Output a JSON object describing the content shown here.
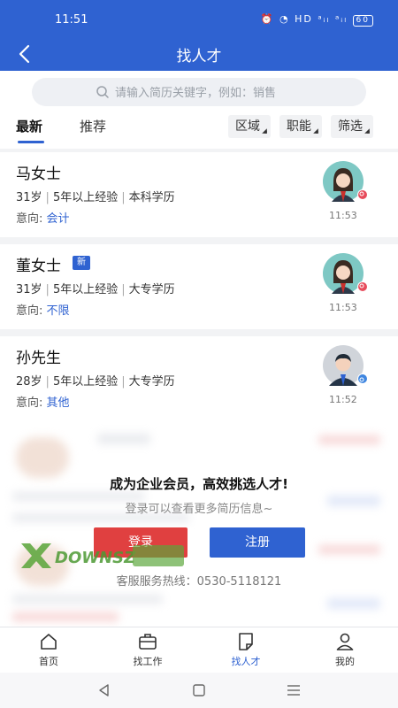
{
  "status_bar": {
    "time": "11:51",
    "battery": "60",
    "signal": "HD ᵃᵢₗ ᵃᵢₗ"
  },
  "nav": {
    "title": "找人才",
    "back_icon": "back-arrow-icon"
  },
  "search": {
    "placeholder": "请输入简历关键字，例如：销售"
  },
  "tabs": {
    "latest": "最新",
    "recommend": "推荐"
  },
  "filters": {
    "region": "区域",
    "job": "职能",
    "filter": "筛选"
  },
  "candidates": [
    {
      "name": "马女士",
      "age": "31岁",
      "experience": "5年以上经验",
      "education": "本科学历",
      "intent_label": "意向:",
      "intent": "会计",
      "time": "11:53",
      "gender": "female",
      "is_new": false
    },
    {
      "name": "董女士",
      "badge": "新",
      "age": "31岁",
      "experience": "5年以上经验",
      "education": "大专学历",
      "intent_label": "意向:",
      "intent": "不限",
      "time": "11:53",
      "gender": "female",
      "is_new": true
    },
    {
      "name": "孙先生",
      "age": "28岁",
      "experience": "5年以上经验",
      "education": "大专学历",
      "intent_label": "意向:",
      "intent": "其他",
      "time": "11:52",
      "gender": "male",
      "is_new": false
    }
  ],
  "member_prompt": {
    "title": "成为企业会员，高效挑选人才!",
    "subtitle": "登录可以查看更多简历信息~",
    "login_label": "登录",
    "register_label": "注册",
    "hotline": "客服服务热线：0530-5118121"
  },
  "watermark": "DOWNSZ",
  "bottom_nav": [
    {
      "label": "首页",
      "icon": "home-icon"
    },
    {
      "label": "找工作",
      "icon": "briefcase-icon"
    },
    {
      "label": "找人才",
      "icon": "resume-icon"
    },
    {
      "label": "我的",
      "icon": "user-icon"
    }
  ],
  "colors": {
    "primary": "#2f62d1",
    "login": "#e04040",
    "female_avatar_bg": "#7ec8c4",
    "male_avatar_bg": "#d0d4da"
  }
}
